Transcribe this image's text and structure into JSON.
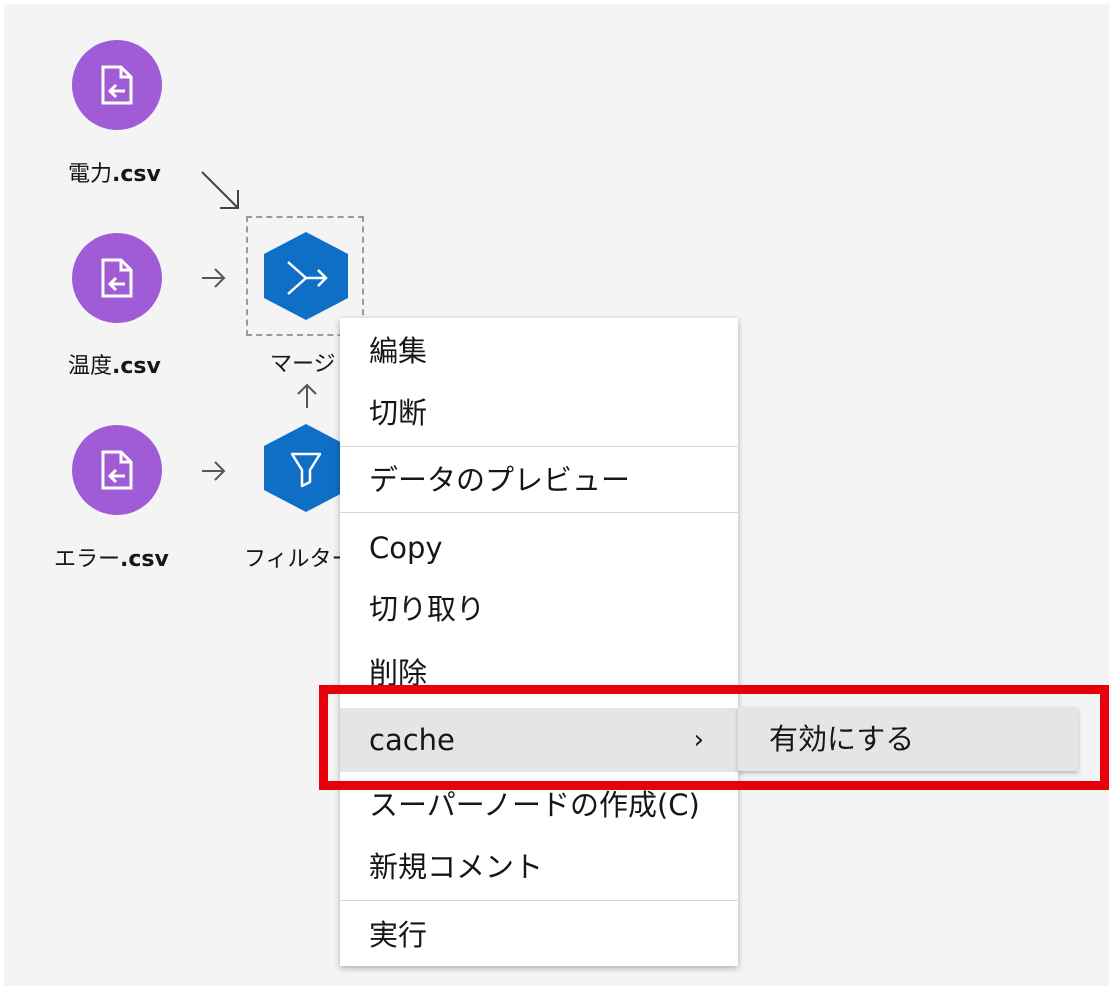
{
  "canvas": {
    "nodes": {
      "power_csv": {
        "name": "電力",
        "ext": ".csv",
        "icon": "file-import-icon"
      },
      "temp_csv": {
        "name": "温度",
        "ext": ".csv",
        "icon": "file-import-icon"
      },
      "error_csv": {
        "name": "エラー",
        "ext": ".csv",
        "icon": "file-import-icon"
      },
      "merge": {
        "label": "マージ",
        "icon": "merge-icon"
      },
      "filter": {
        "label": "フィルター",
        "icon": "filter-icon"
      }
    },
    "colors": {
      "source": "#a05bd6",
      "operator": "#0f6fc6",
      "highlight": "#e8000b"
    }
  },
  "context_menu": {
    "edit": "編集",
    "disconnect": "切断",
    "preview": "データのプレビュー",
    "copy": "Copy",
    "cut": "切り取り",
    "delete": "削除",
    "cache": "cache",
    "cache_chevron": "›",
    "create_supernode": "スーパーノードの作成(C)",
    "new_comment": "新規コメント",
    "run": "実行"
  },
  "submenu": {
    "enable": "有効にする"
  }
}
